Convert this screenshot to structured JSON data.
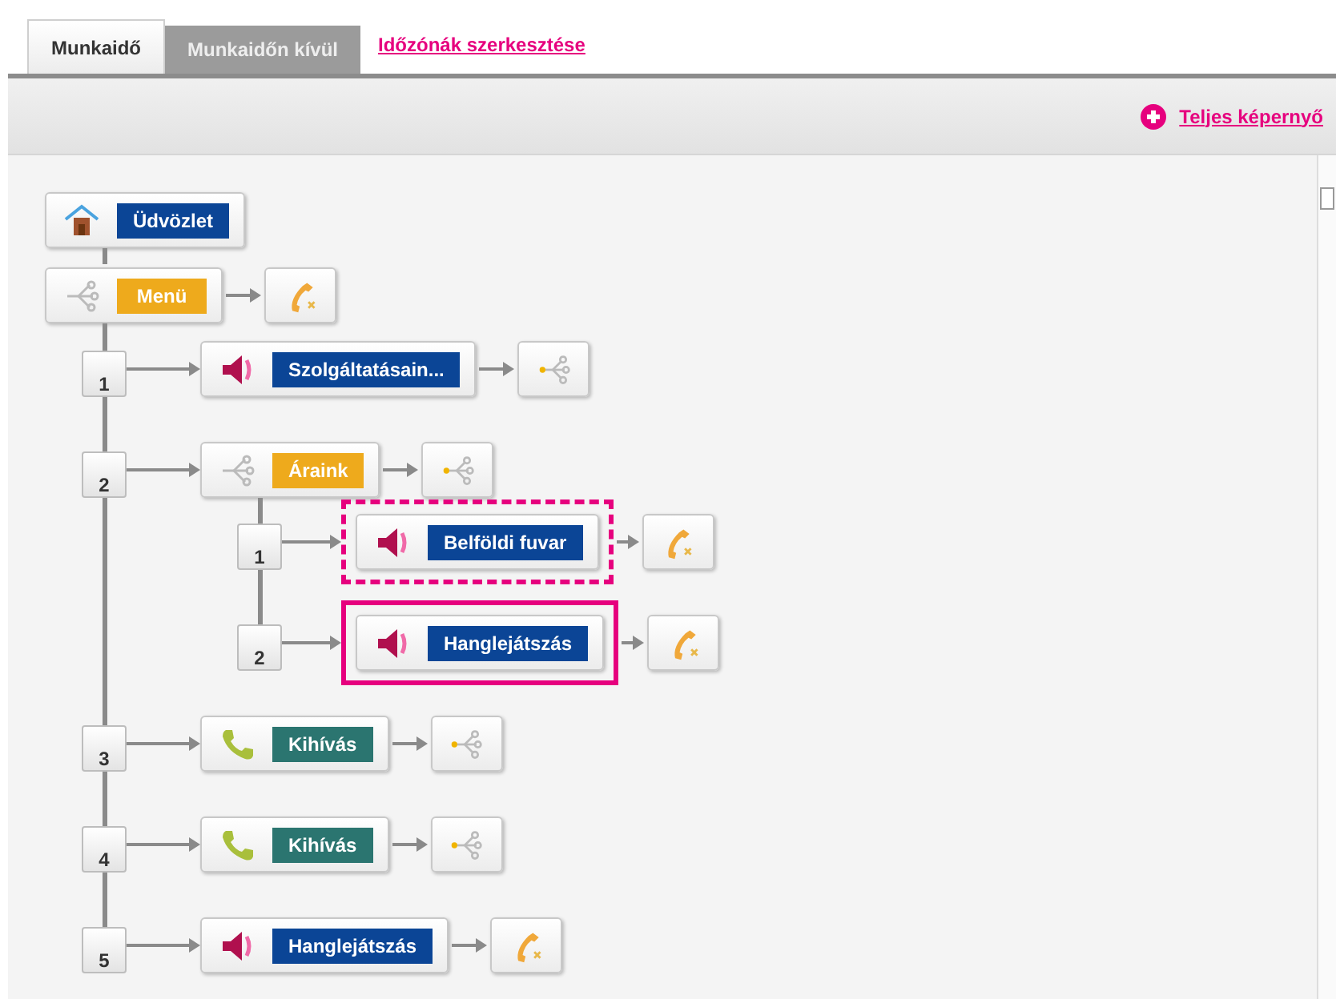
{
  "tabs": [
    {
      "label": "Munkaidő",
      "selected": true
    },
    {
      "label": "Munkaidőn kívül",
      "selected": false
    }
  ],
  "edit_link": "Időzónák szerkesztése",
  "fullscreen_link": "Teljes képernyő",
  "flow": {
    "start": {
      "kind": "welcome",
      "label": "Üdvözlet"
    },
    "menu": {
      "kind": "menu",
      "label": "Menü",
      "next": {
        "kind": "hangup"
      },
      "options": [
        {
          "number": "1",
          "kind": "playback",
          "label": "Szolgáltatásain...",
          "next": {
            "kind": "menu"
          }
        },
        {
          "number": "2",
          "kind": "menu",
          "label": "Áraink",
          "next": {
            "kind": "menu"
          },
          "children": [
            {
              "number": "1",
              "kind": "playback",
              "label": "Belföldi fuvar",
              "next": {
                "kind": "hangup"
              },
              "frame": {
                "kind": "dashed"
              }
            },
            {
              "number": "2",
              "kind": "playback",
              "label": "Hanglejátszás",
              "next": {
                "kind": "hangup"
              },
              "frame": {
                "kind": "solid"
              }
            }
          ]
        },
        {
          "number": "3",
          "kind": "call",
          "label": "Kihívás",
          "next": {
            "kind": "menu"
          }
        },
        {
          "number": "4",
          "kind": "call",
          "label": "Kihívás",
          "next": {
            "kind": "menu"
          }
        },
        {
          "number": "5",
          "kind": "playback",
          "label": "Hanglejátszás",
          "next": {
            "kind": "hangup"
          }
        }
      ]
    }
  }
}
